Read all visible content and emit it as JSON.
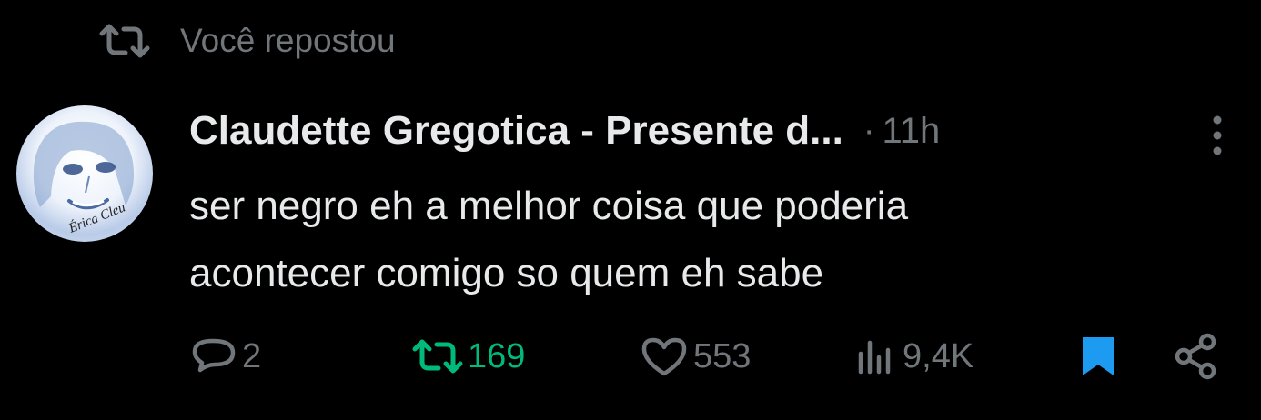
{
  "repost_banner": {
    "label": "Você repostou",
    "icon": "repost-icon"
  },
  "tweet": {
    "author_name": "Claudette Gregotica - Presente d...",
    "separator": "·",
    "time": "11h",
    "text_lines": [
      "ser negro eh a melhor coisa que poderia",
      "acontecer comigo so quem eh sabe"
    ],
    "avatar_signature": "Érica Cleu",
    "more_icon": "more-vertical-icon"
  },
  "actions": {
    "replies": {
      "icon": "reply-icon",
      "count": "2"
    },
    "reposts": {
      "icon": "repost-icon",
      "count": "169",
      "active": true
    },
    "likes": {
      "icon": "heart-icon",
      "count": "553"
    },
    "views": {
      "icon": "views-icon",
      "count": "9,4K"
    },
    "bookmark": {
      "icon": "bookmark-icon",
      "active": true
    },
    "share": {
      "icon": "share-icon"
    }
  },
  "colors": {
    "background": "#000000",
    "text_primary": "#e7e9ea",
    "text_secondary": "#71767b",
    "repost_green": "#00ba7c",
    "bookmark_blue": "#1d9bf0"
  }
}
